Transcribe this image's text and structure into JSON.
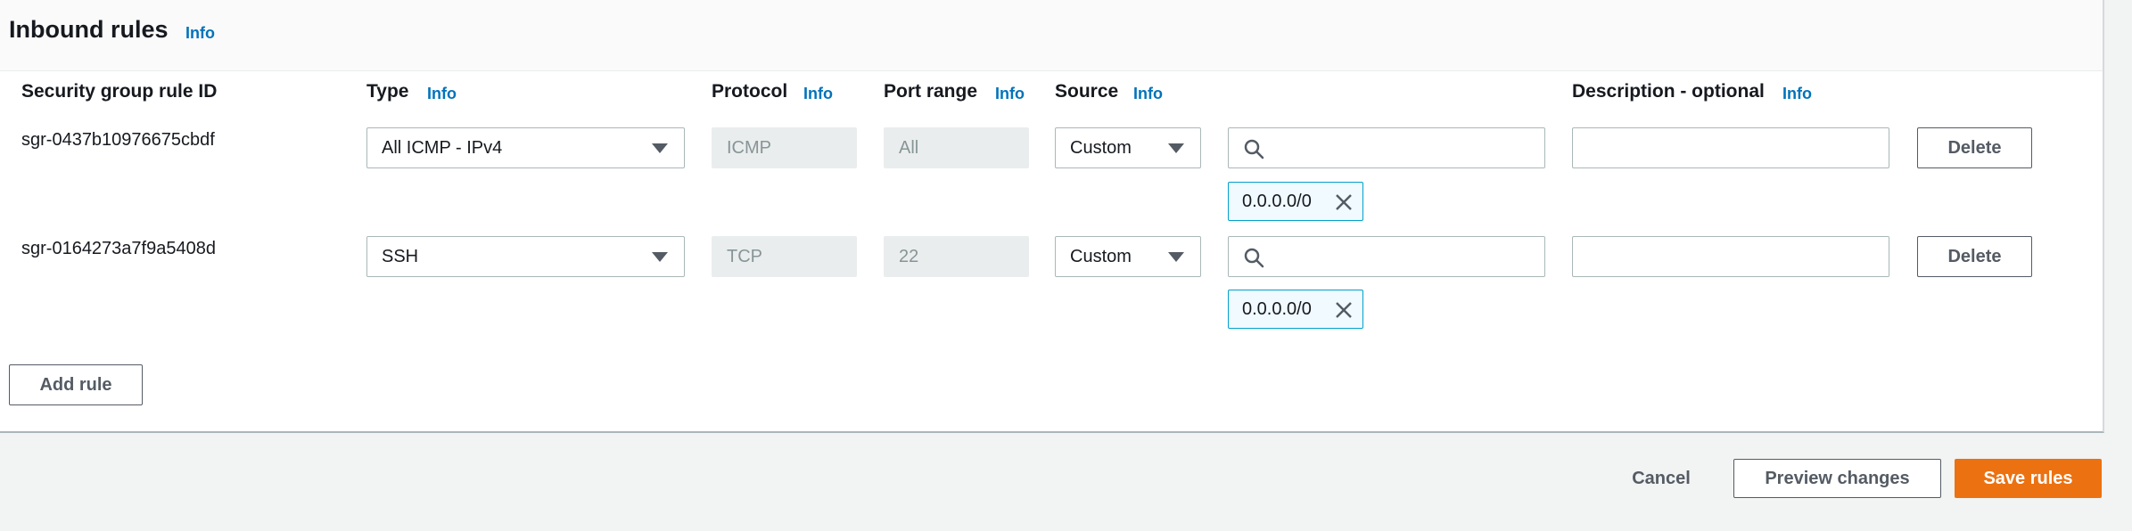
{
  "section": {
    "title": "Inbound rules",
    "info": "Info"
  },
  "columns": {
    "rule_id": "Security group rule ID",
    "type": "Type",
    "protocol": "Protocol",
    "port_range": "Port range",
    "source": "Source",
    "description": "Description - optional",
    "info": "Info"
  },
  "rules": [
    {
      "id": "sgr-0437b10976675cbdf",
      "type": "All ICMP - IPv4",
      "protocol": "ICMP",
      "port_range": "All",
      "source": "Custom",
      "search_value": "",
      "cidr": "0.0.0.0/0",
      "description": "",
      "delete": "Delete"
    },
    {
      "id": "sgr-0164273a7f9a5408d",
      "type": "SSH",
      "protocol": "TCP",
      "port_range": "22",
      "source": "Custom",
      "search_value": "",
      "cidr": "0.0.0.0/0",
      "description": "",
      "delete": "Delete"
    }
  ],
  "add_rule": "Add rule",
  "footer": {
    "cancel": "Cancel",
    "preview": "Preview changes",
    "save": "Save rules"
  },
  "colors": {
    "accent": "#ec7211",
    "link": "#0073bb",
    "token_border": "#00a1c9"
  },
  "icons": {
    "search": "search-icon",
    "dropdown": "caret-down-icon",
    "remove": "close-icon"
  }
}
